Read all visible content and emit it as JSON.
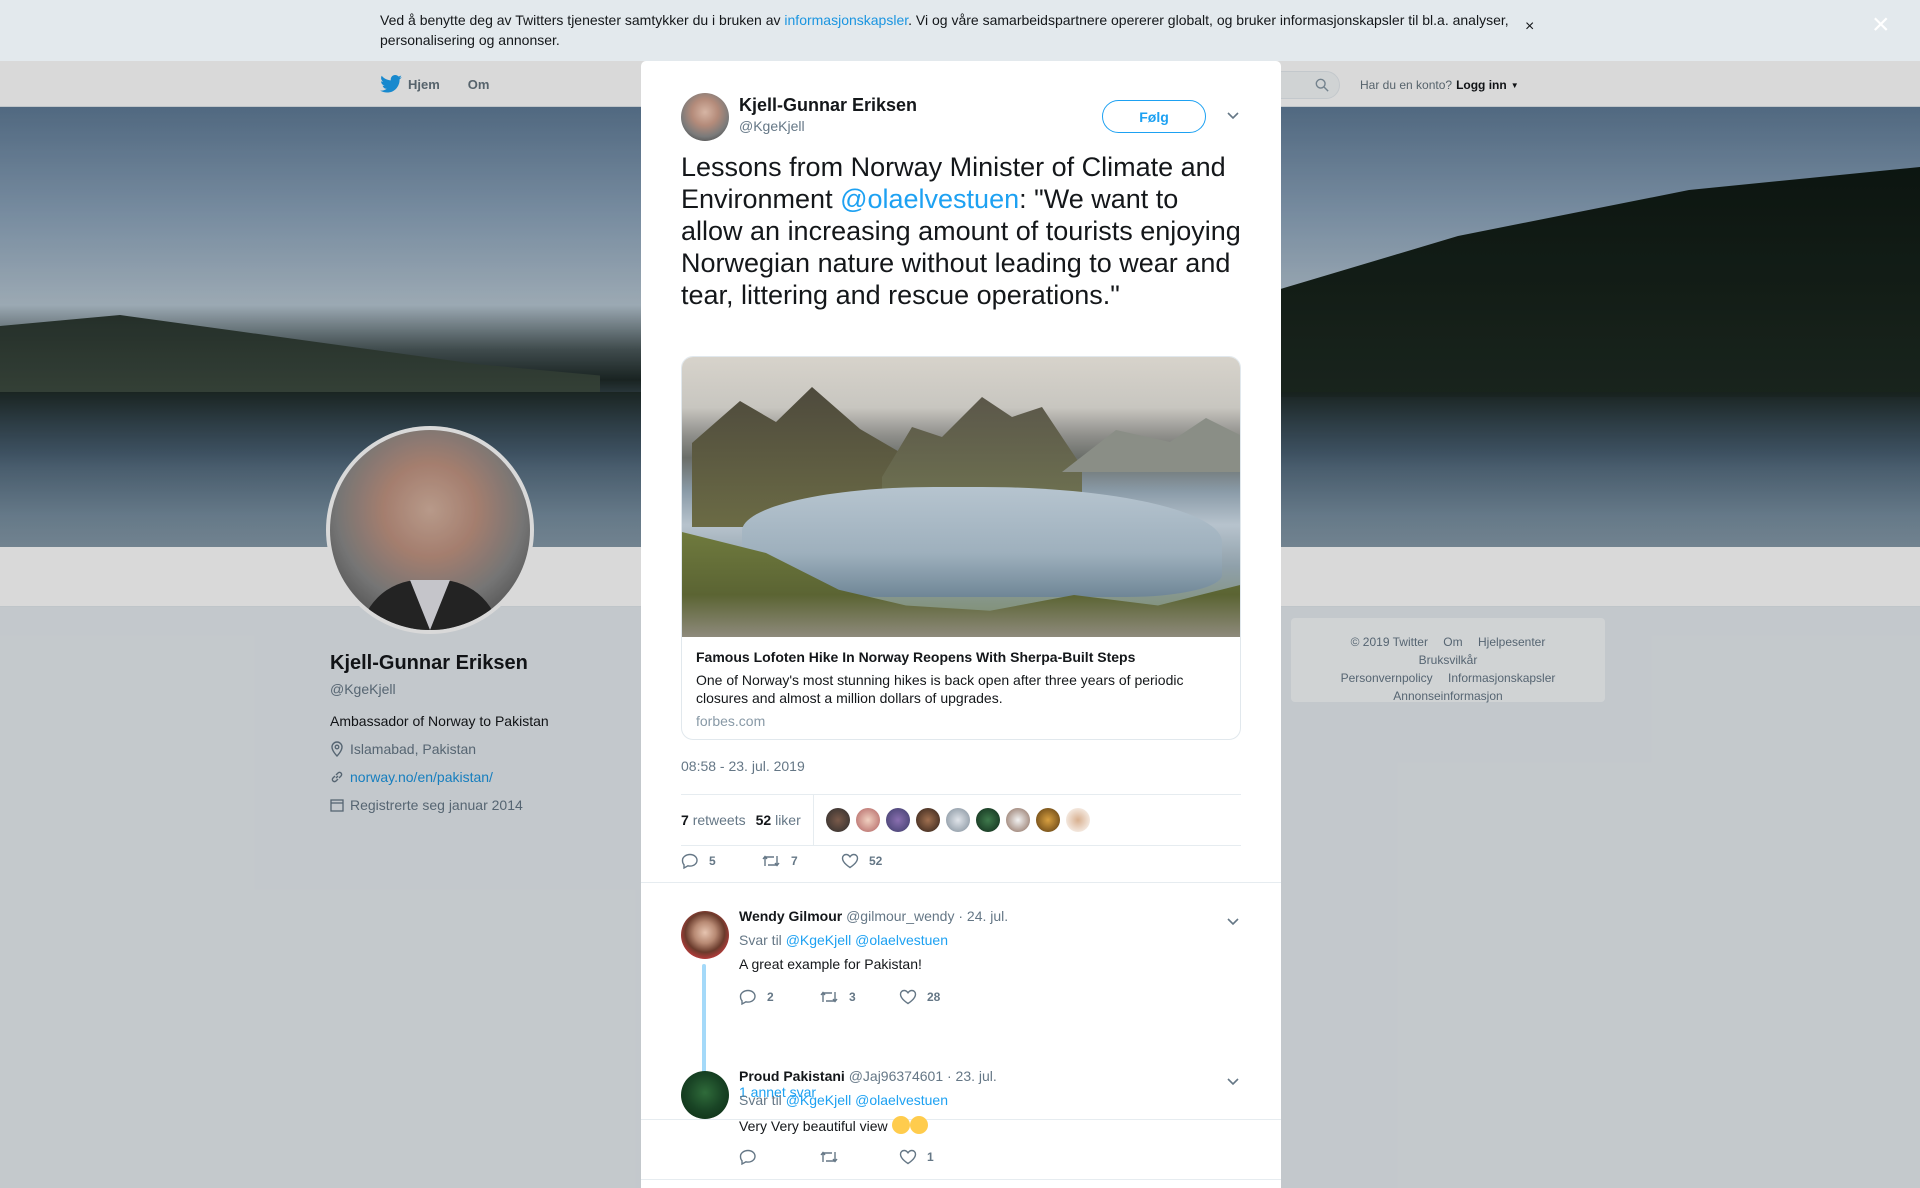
{
  "cookie_banner": {
    "text_before": "Ved å benytte deg av Twitters tjenester samtykker du i bruken av ",
    "link": "informasjonskapsler",
    "text_after": ". Vi og våre samarbeidspartnere opererer globalt, og bruker informasjonskapsler til bl.a. analyser, personalisering og annonser.",
    "close_icon": "×"
  },
  "modal_close_icon": "×",
  "nav": {
    "home": "Hjem",
    "about": "Om",
    "have_account": "Har du en konto?",
    "login": "Logg inn"
  },
  "profile": {
    "name": "Kjell-Gunnar Eriksen",
    "handle": "@KgeKjell",
    "bio": "Ambassador of Norway to Pakistan",
    "location": "Islamabad, Pakistan",
    "website": "norway.no/en/pakistan/",
    "joined": "Registrerte seg januar 2014"
  },
  "footer": {
    "copyright": "© 2019 Twitter",
    "about": "Om",
    "help": "Hjelpesenter",
    "terms": "Bruksvilkår",
    "privacy": "Personvernpolicy",
    "cookies": "Informasjonskapsler",
    "ads": "Annonseinformasjon"
  },
  "tweet": {
    "author_name": "Kjell-Gunnar Eriksen",
    "author_handle": "@KgeKjell",
    "follow_label": "Følg",
    "text_before": "Lessons from Norway Minister of Climate and Environment ",
    "mention": "@olaelvestuen",
    "text_after": ": \"We want to allow an increasing amount of tourists enjoying Norwegian nature without leading to wear and tear, littering and rescue operations.\"",
    "card": {
      "title": "Famous Lofoten Hike In Norway Reopens With Sherpa-Built Steps",
      "description": "One of Norway's most stunning hikes is back open after three years of periodic closures and almost a million dollars of upgrades.",
      "domain": "forbes.com"
    },
    "timestamp": "08:58 - 23. jul. 2019",
    "retweets_count": "7",
    "retweets_label": "retweets",
    "likes_count": "52",
    "likes_label": "liker",
    "actions": {
      "reply_count": "5",
      "retweet_count": "7",
      "like_count": "52"
    }
  },
  "replies": [
    {
      "name": "Wendy Gilmour",
      "handle": "@gilmour_wendy",
      "date": "· 24. jul.",
      "reply_to_label": "Svar til",
      "reply_to_1": "@KgeKjell",
      "reply_to_2": "@olaelvestuen",
      "text": "A great example for Pakistan!",
      "reply_count": "2",
      "retweet_count": "3",
      "like_count": "28",
      "more_replies": "1 annet svar"
    },
    {
      "name": "Proud Pakistani",
      "handle": "@Jaj96374601",
      "date": "· 23. jul.",
      "reply_to_label": "Svar til",
      "reply_to_1": "@KgeKjell",
      "reply_to_2": "@olaelvestuen",
      "text": "Very Very beautiful view",
      "reply_count": "",
      "retweet_count": "",
      "like_count": "1"
    }
  ],
  "colors": {
    "accent": "#1da1f2",
    "link": "#1b95e0",
    "muted": "#657786",
    "text": "#14171a"
  }
}
